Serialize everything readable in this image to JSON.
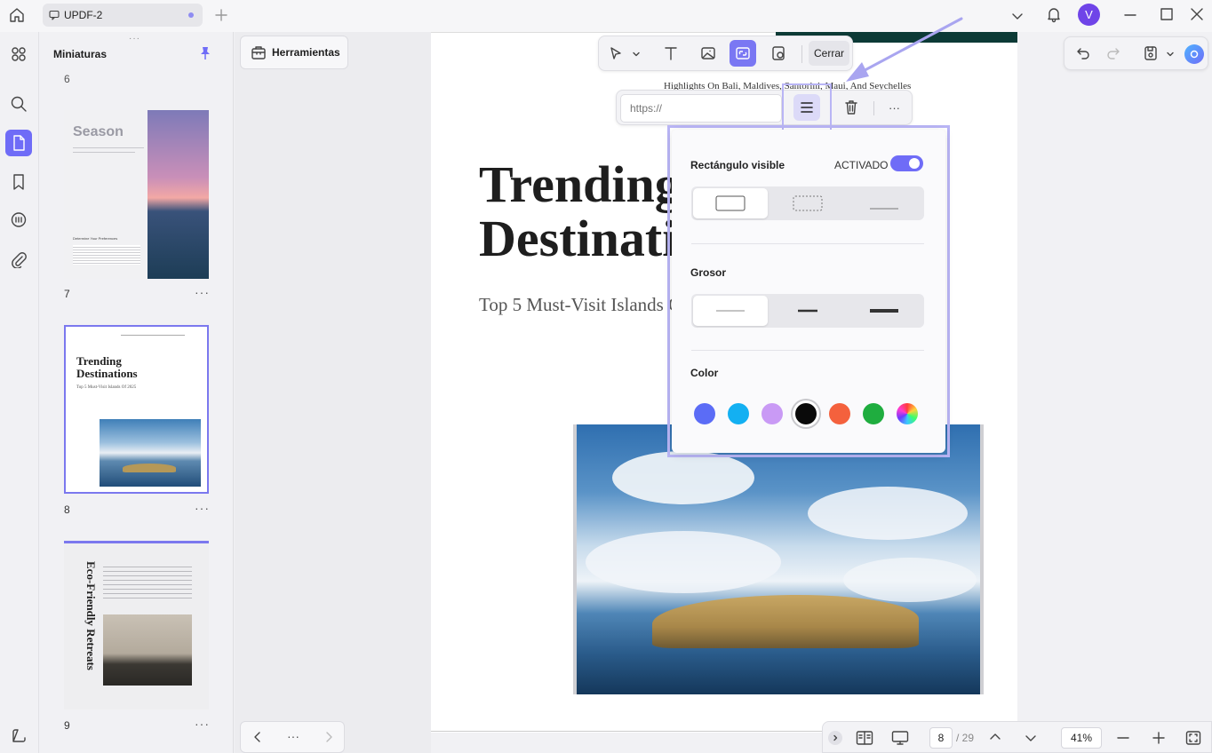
{
  "titlebar": {
    "tab_title": "UPDF-2",
    "avatar_initial": "V"
  },
  "thumbnails": {
    "title": "Miniaturas",
    "top_page_label": "6",
    "pages": [
      {
        "number": "7",
        "title": "Season",
        "heading": "Determine Your Preferences"
      },
      {
        "number": "8",
        "title_line1": "Trending",
        "title_line2": "Destinations",
        "subtitle": "Top 5 Must-Visit Islands Of 2025"
      },
      {
        "number": "9",
        "title": "Eco-Friendly Retreats"
      }
    ],
    "more_label": "···"
  },
  "tools": {
    "button_label": "Herramientas",
    "pager_more": "···"
  },
  "document": {
    "header_line": "Highlights On Bali, Maldives, Santorini, Maui, And Seychelles",
    "title_line1": "Trending",
    "title_line2": "Destinations",
    "subtitle": "Top 5 Must-Visit Islands Of 2025"
  },
  "link_toolbar": {
    "close_label": "Cerrar"
  },
  "link_bar": {
    "url_placeholder": "https://",
    "more_label": "···"
  },
  "popup": {
    "visible_rect_label": "Rectángulo visible",
    "toggle_label": "ACTIVADO",
    "toggle_on": true,
    "thickness_label": "Grosor",
    "color_label": "Color",
    "colors": [
      "#5b6cf6",
      "#13b0f2",
      "#c99af5",
      "#0a0a0a",
      "#f4613d",
      "#1fad3f",
      "rainbow"
    ],
    "selected_color_index": 3
  },
  "bottombar": {
    "current_page": "8",
    "total_pages": "/ 29",
    "zoom": "41%"
  },
  "accent_color": "#6f6cf7"
}
